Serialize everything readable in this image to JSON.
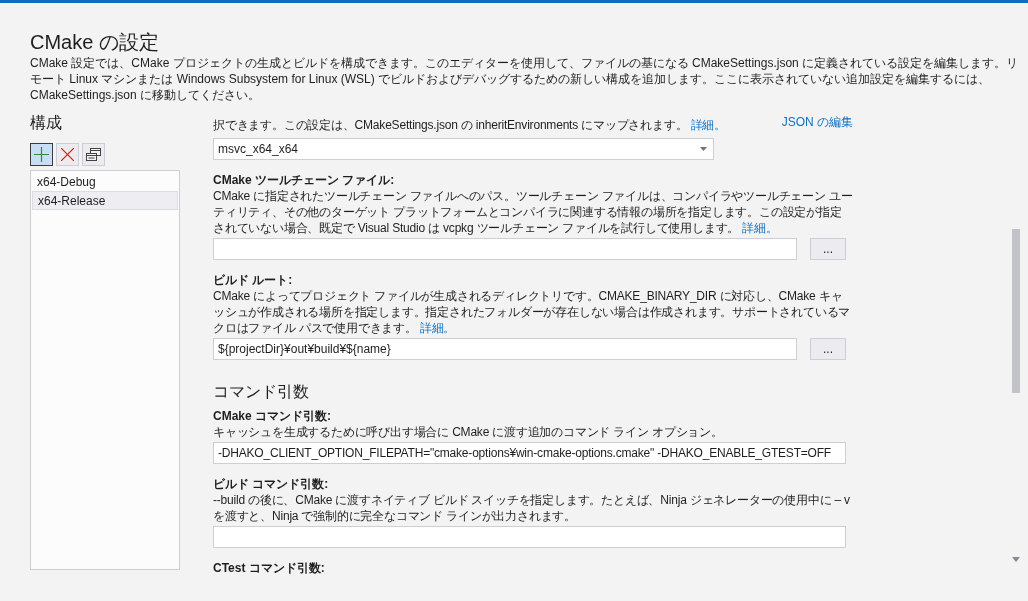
{
  "window": {
    "title": "CMake の設定",
    "description": "CMake 設定では、CMake プロジェクトの生成とビルドを構成できます。このエディターを使用して、ファイルの基になる CMakeSettings.json に定義されている設定を編集します。リモート Linux マシンまたは Windows Subsystem for Linux (WSL) でビルドおよびデバッグするための新しい構成を追加します。ここに表示されていない追加設定を編集するには、CMakeSettings.json に移動してください。"
  },
  "configurations": {
    "heading": "構成",
    "toolbar": [
      {
        "kind": "add",
        "highlighted": true
      },
      {
        "kind": "remove",
        "highlighted": false
      },
      {
        "kind": "copy",
        "highlighted": false
      }
    ],
    "items": [
      {
        "label": "x64-Debug",
        "selected": false
      },
      {
        "label": "x64-Release",
        "selected": true
      }
    ]
  },
  "edit_json_link": "JSON の編集",
  "settings": [
    {
      "kind": "dropdown",
      "description": "択できます。この設定は、CMakeSettings.json の inheritEnvironments にマップされます。",
      "link": "詳細。",
      "value": "msvc_x64_x64"
    },
    {
      "kind": "path",
      "label": "CMake ツールチェーン ファイル:",
      "description": "CMake に指定されたツールチェーン ファイルへのパス。ツールチェーン ファイルは、コンパイラやツールチェーン ユーティリティ、その他のターゲット プラットフォームとコンパイラに関連する情報の場所を指定します。この設定が指定されていない場合、既定で Visual Studio は vcpkg ツールチェーン ファイルを試行して使用します。",
      "link": "詳細。",
      "button": "..."
    },
    {
      "kind": "path",
      "label": "ビルド ルート:",
      "description": "CMake によってプロジェクト ファイルが生成されるディレクトリです。CMAKE_BINARY_DIR に対応し、CMake キャッシュが作成される場所を指定します。指定されたフォルダーが存在しない場合は作成されます。サポートされているマクロはファイル パスで使用できます。",
      "link": "詳細。",
      "value": "${projectDir}¥out¥build¥${name}",
      "button": "..."
    },
    {
      "kind": "heading",
      "title": "コマンド引数"
    },
    {
      "kind": "text",
      "label": "CMake コマンド引数:",
      "description": "キャッシュを生成するために呼び出す場合に CMake に渡す追加のコマンド ライン オプション。",
      "value": "-DHAKO_CLIENT_OPTION_FILEPATH=\"cmake-options¥win-cmake-options.cmake\" -DHAKO_ENABLE_GTEST=OFF"
    },
    {
      "kind": "text",
      "label": "ビルド コマンド引数:",
      "description": "--build の後に、CMake に渡すネイティブ ビルド スイッチを指定します。たとえば、Ninja ジェネレーターの使用中に – v を渡すと、Ninja で強制的に完全なコマンド ラインが出力されます。"
    },
    {
      "kind": "label",
      "label": "CTest コマンド引数:"
    }
  ]
}
